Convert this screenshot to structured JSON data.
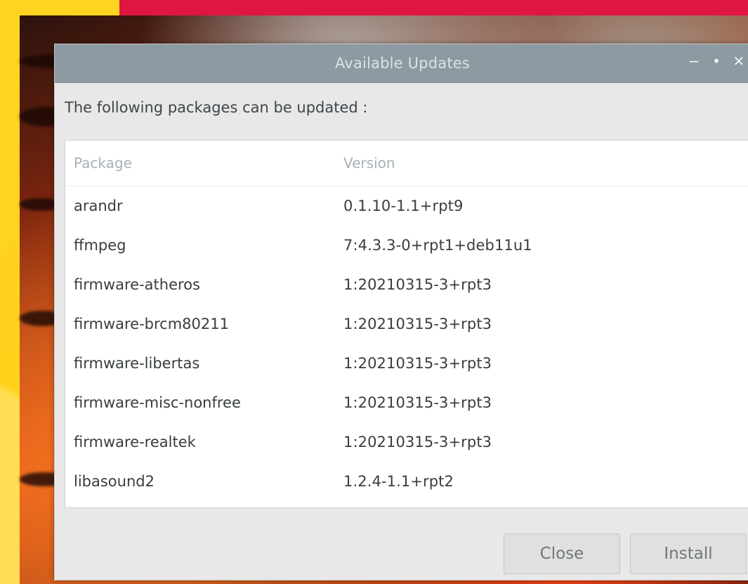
{
  "dialog": {
    "title": "Available Updates",
    "controls": [
      "−",
      "•",
      "✕"
    ],
    "prompt": "The following packages can be updated :"
  },
  "table": {
    "headers": {
      "package": "Package",
      "version": "Version"
    },
    "rows": [
      {
        "package": "arandr",
        "version": "0.1.10-1.1+rpt9"
      },
      {
        "package": "ffmpeg",
        "version": "7:4.3.3-0+rpt1+deb11u1"
      },
      {
        "package": "firmware-atheros",
        "version": "1:20210315-3+rpt3"
      },
      {
        "package": "firmware-brcm80211",
        "version": "1:20210315-3+rpt3"
      },
      {
        "package": "firmware-libertas",
        "version": "1:20210315-3+rpt3"
      },
      {
        "package": "firmware-misc-nonfree",
        "version": "1:20210315-3+rpt3"
      },
      {
        "package": "firmware-realtek",
        "version": "1:20210315-3+rpt3"
      },
      {
        "package": "libasound2",
        "version": "1.2.4-1.1+rpt2"
      }
    ]
  },
  "buttons": {
    "close": "Close",
    "install": "Install"
  }
}
